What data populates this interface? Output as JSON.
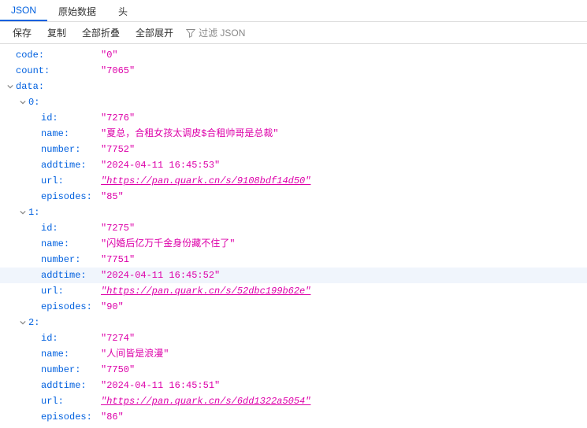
{
  "tabs": [
    {
      "label": "JSON",
      "active": true
    },
    {
      "label": "原始数据",
      "active": false
    },
    {
      "label": "头",
      "active": false
    }
  ],
  "toolbar": {
    "save": "保存",
    "copy": "复制",
    "collapse_all": "全部折叠",
    "expand_all": "全部展开",
    "filter_placeholder": "过滤 JSON"
  },
  "rows": [
    {
      "depth": 0,
      "twisty": false,
      "key": "code",
      "val": "\"0\"",
      "link": false,
      "hl": false
    },
    {
      "depth": 0,
      "twisty": false,
      "key": "count",
      "val": "\"7065\"",
      "link": false,
      "hl": false
    },
    {
      "depth": 0,
      "twisty": true,
      "key": "data",
      "val": "",
      "link": false,
      "hl": false
    },
    {
      "depth": 1,
      "twisty": true,
      "key": "0",
      "val": "",
      "link": false,
      "hl": false
    },
    {
      "depth": 2,
      "twisty": false,
      "key": "id",
      "val": "\"7276\"",
      "link": false,
      "hl": false
    },
    {
      "depth": 2,
      "twisty": false,
      "key": "name",
      "val": "\"夏总，合租女孩太调皮$合租帅哥是总裁\"",
      "link": false,
      "hl": false
    },
    {
      "depth": 2,
      "twisty": false,
      "key": "number",
      "val": "\"7752\"",
      "link": false,
      "hl": false
    },
    {
      "depth": 2,
      "twisty": false,
      "key": "addtime",
      "val": "\"2024-04-11 16:45:53\"",
      "link": false,
      "hl": false
    },
    {
      "depth": 2,
      "twisty": false,
      "key": "url",
      "val": "\"https://pan.quark.cn/s/9108bdf14d50\"",
      "link": true,
      "hl": false
    },
    {
      "depth": 2,
      "twisty": false,
      "key": "episodes",
      "val": "\"85\"",
      "link": false,
      "hl": false
    },
    {
      "depth": 1,
      "twisty": true,
      "key": "1",
      "val": "",
      "link": false,
      "hl": false
    },
    {
      "depth": 2,
      "twisty": false,
      "key": "id",
      "val": "\"7275\"",
      "link": false,
      "hl": false
    },
    {
      "depth": 2,
      "twisty": false,
      "key": "name",
      "val": "\"闪婚后亿万千金身份藏不住了\"",
      "link": false,
      "hl": false
    },
    {
      "depth": 2,
      "twisty": false,
      "key": "number",
      "val": "\"7751\"",
      "link": false,
      "hl": false
    },
    {
      "depth": 2,
      "twisty": false,
      "key": "addtime",
      "val": "\"2024-04-11 16:45:52\"",
      "link": false,
      "hl": true
    },
    {
      "depth": 2,
      "twisty": false,
      "key": "url",
      "val": "\"https://pan.quark.cn/s/52dbc199b62e\"",
      "link": true,
      "hl": false
    },
    {
      "depth": 2,
      "twisty": false,
      "key": "episodes",
      "val": "\"90\"",
      "link": false,
      "hl": false
    },
    {
      "depth": 1,
      "twisty": true,
      "key": "2",
      "val": "",
      "link": false,
      "hl": false
    },
    {
      "depth": 2,
      "twisty": false,
      "key": "id",
      "val": "\"7274\"",
      "link": false,
      "hl": false
    },
    {
      "depth": 2,
      "twisty": false,
      "key": "name",
      "val": "\"人间皆是浪漫\"",
      "link": false,
      "hl": false
    },
    {
      "depth": 2,
      "twisty": false,
      "key": "number",
      "val": "\"7750\"",
      "link": false,
      "hl": false
    },
    {
      "depth": 2,
      "twisty": false,
      "key": "addtime",
      "val": "\"2024-04-11 16:45:51\"",
      "link": false,
      "hl": false
    },
    {
      "depth": 2,
      "twisty": false,
      "key": "url",
      "val": "\"https://pan.quark.cn/s/6dd1322a5054\"",
      "link": true,
      "hl": false
    },
    {
      "depth": 2,
      "twisty": false,
      "key": "episodes",
      "val": "\"86\"",
      "link": false,
      "hl": false
    }
  ]
}
